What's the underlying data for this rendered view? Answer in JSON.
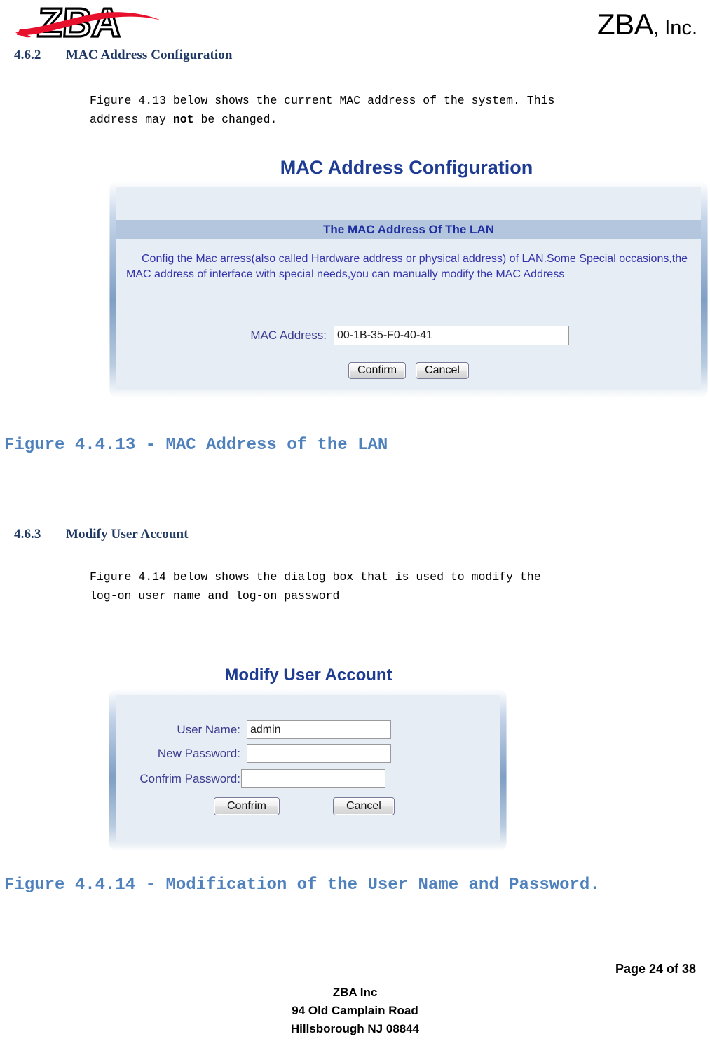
{
  "header": {
    "logo_text": "ZBA",
    "logo_alt": "zba-logo",
    "company_main": "ZBA",
    "company_suffix": ", Inc."
  },
  "sections": [
    {
      "number": "4.6.2",
      "title": "MAC Address Configuration",
      "paragraph_line1": "Figure 4.13 below shows the current MAC address of the system. This",
      "paragraph_line2_pre": "address may ",
      "paragraph_line2_bold": "not",
      "paragraph_line2_post": " be changed."
    },
    {
      "number": "4.6.3",
      "title": "Modify User Account",
      "paragraph_line1": "Figure 4.14 below shows the dialog box that is used to modify the",
      "paragraph_line2": "log-on user name and log-on password"
    }
  ],
  "mac_dialog": {
    "title": "MAC Address Configuration",
    "lan_bar": "The MAC Address Of The LAN",
    "description": "Config the Mac arress(also called Hardware address or physical address) of LAN.Some Special occasions,the MAC address of interface with special needs,you can manually modify the MAC Address",
    "mac_label": "MAC Address:",
    "mac_value": "00-1B-35-F0-40-41",
    "confirm_label": "Confirm",
    "cancel_label": "Cancel"
  },
  "user_dialog": {
    "title": "Modify User Account",
    "username_label": "User Name:",
    "username_value": "admin",
    "new_password_label": "New Password:",
    "new_password_value": "",
    "confirm_password_label": "Confrim Password:",
    "confirm_password_value": "",
    "confirm_label": "Confrim",
    "cancel_label": "Cancel"
  },
  "captions": {
    "figure_13": "Figure 4.4.13 - MAC Address of the LAN",
    "figure_14": "Figure 4.4.14 - Modification of the User Name and Password."
  },
  "footer": {
    "page_number": "Page 24 of 38",
    "company": "ZBA Inc",
    "address_line1": "94 Old Camplain Road",
    "address_line2": "Hillsborough NJ 08844"
  },
  "colors": {
    "heading_navy": "#1F3864",
    "caption_blue": "#4F81BD",
    "panel_title_blue": "#1F3C93",
    "lan_bar_bg": "#b3c6de",
    "panel_bg": "#e7edf5",
    "logo_red": "#E8112D"
  }
}
